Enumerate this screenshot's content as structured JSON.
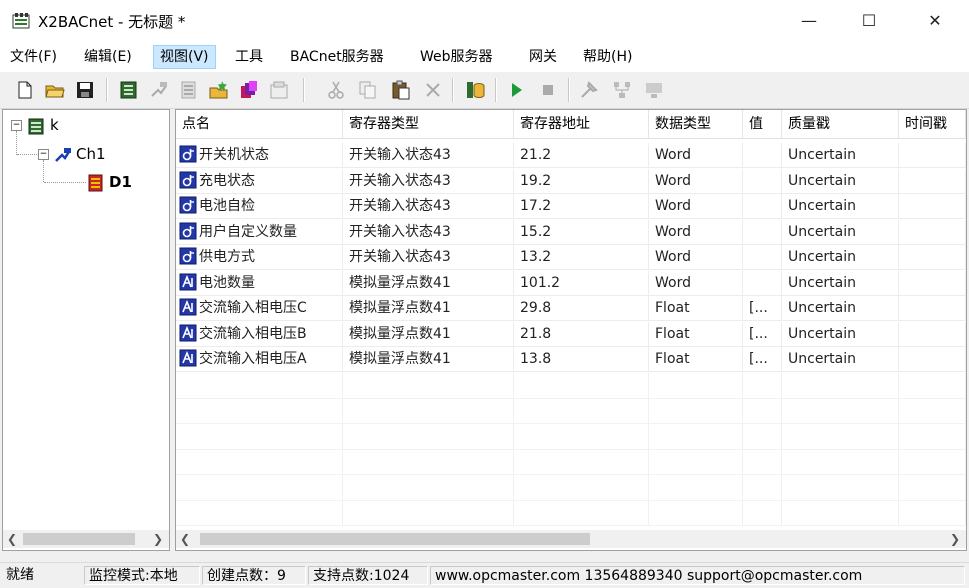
{
  "window": {
    "title": "X2BACnet - 无标题 *"
  },
  "menu": [
    {
      "label": "文件(F)"
    },
    {
      "label": "编辑(E)"
    },
    {
      "label": "视图(V)"
    },
    {
      "label": "工具"
    },
    {
      "label": "BACnet服务器"
    },
    {
      "label": "Web服务器"
    },
    {
      "label": "网关"
    },
    {
      "label": "帮助(H)"
    }
  ],
  "tree": {
    "root": "k",
    "channel": "Ch1",
    "device": "D1"
  },
  "table": {
    "columns": [
      "点名",
      "寄存器类型",
      "寄存器地址",
      "数据类型",
      "值",
      "质量戳",
      "时间戳"
    ],
    "rows": [
      {
        "name": "开关机状态",
        "reg_type": "开关输入状态43",
        "address": "21.2",
        "data_type": "Word",
        "value": "",
        "quality": "Uncertain",
        "kind": "digital"
      },
      {
        "name": "充电状态",
        "reg_type": "开关输入状态43",
        "address": "19.2",
        "data_type": "Word",
        "value": "",
        "quality": "Uncertain",
        "kind": "digital"
      },
      {
        "name": "电池自检",
        "reg_type": "开关输入状态43",
        "address": "17.2",
        "data_type": "Word",
        "value": "",
        "quality": "Uncertain",
        "kind": "digital"
      },
      {
        "name": "用户自定义数量",
        "reg_type": "开关输入状态43",
        "address": "15.2",
        "data_type": "Word",
        "value": "",
        "quality": "Uncertain",
        "kind": "digital"
      },
      {
        "name": "供电方式",
        "reg_type": "开关输入状态43",
        "address": "13.2",
        "data_type": "Word",
        "value": "",
        "quality": "Uncertain",
        "kind": "digital"
      },
      {
        "name": "电池数量",
        "reg_type": "模拟量浮点数41",
        "address": "101.2",
        "data_type": "Word",
        "value": "",
        "quality": "Uncertain",
        "kind": "analog"
      },
      {
        "name": "交流输入相电压C",
        "reg_type": "模拟量浮点数41",
        "address": "29.8",
        "data_type": "Float",
        "value": "[...",
        "quality": "Uncertain",
        "kind": "analog"
      },
      {
        "name": "交流输入相电压B",
        "reg_type": "模拟量浮点数41",
        "address": "21.8",
        "data_type": "Float",
        "value": "[...",
        "quality": "Uncertain",
        "kind": "analog"
      },
      {
        "name": "交流输入相电压A",
        "reg_type": "模拟量浮点数41",
        "address": "13.8",
        "data_type": "Float",
        "value": "[...",
        "quality": "Uncertain",
        "kind": "analog"
      }
    ]
  },
  "status": {
    "ready": "就绪",
    "mode": "监控模式:本地",
    "created": "创建点数：9",
    "supported": "支持点数:1024",
    "contact": "www.opcmaster.com 13564889340 support@opcmaster.com"
  },
  "icons": {
    "digital_point": "digital-point-icon",
    "analog_point": "analog-point-icon"
  }
}
